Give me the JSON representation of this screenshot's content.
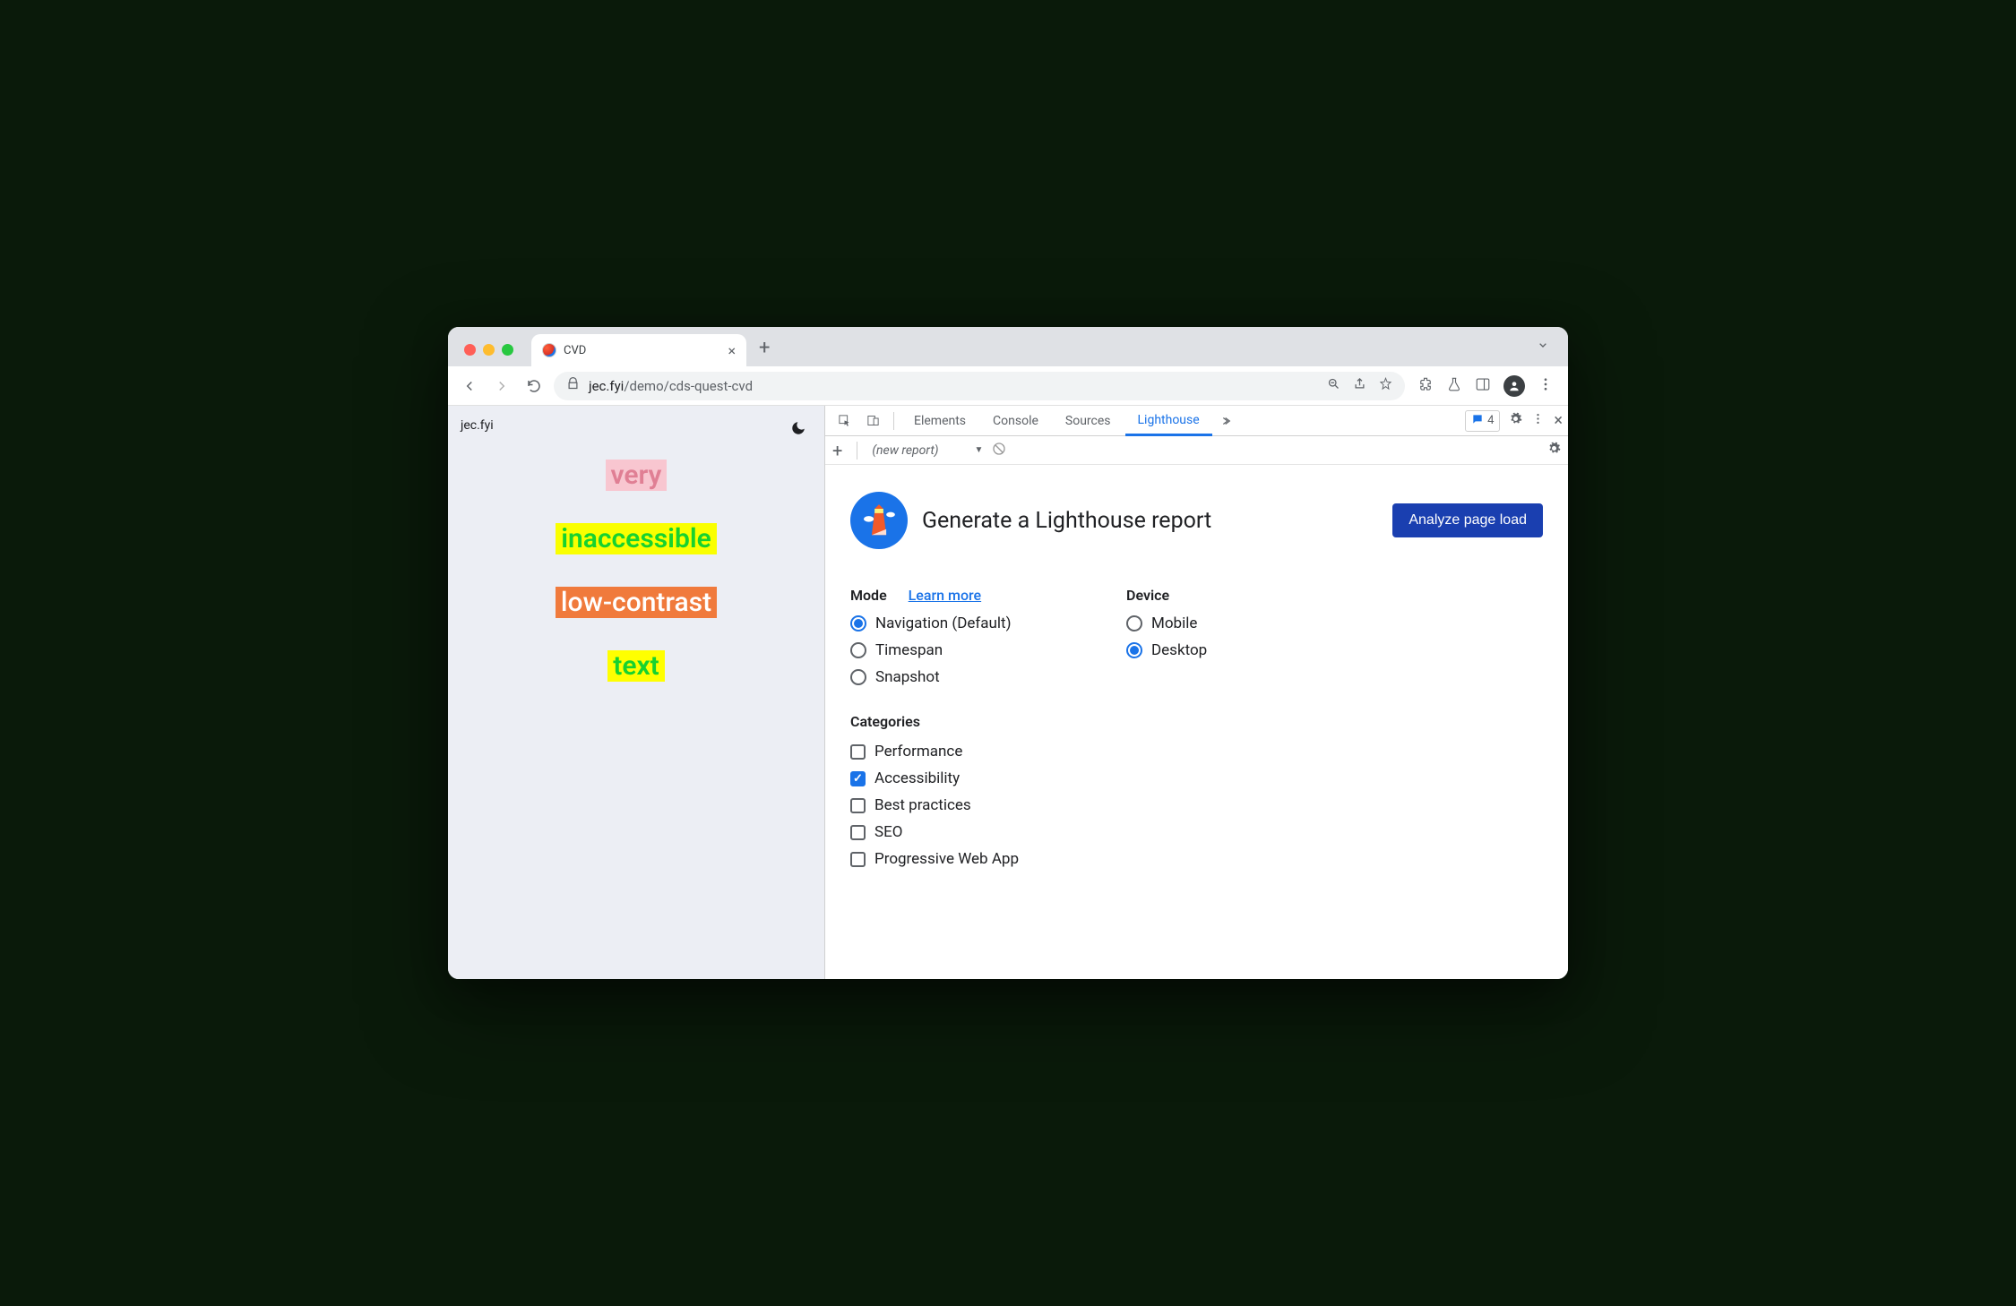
{
  "browser": {
    "tab_title": "CVD",
    "url_display": "jec.fyi/demo/cds-quest-cvd",
    "url_prefix": "jec.fyi",
    "url_suffix": "/demo/cds-quest-cvd"
  },
  "page": {
    "header": "jec.fyi",
    "words": [
      "very",
      "inaccessible",
      "low-contrast",
      "text"
    ]
  },
  "devtools": {
    "tabs": [
      "Elements",
      "Console",
      "Sources",
      "Lighthouse"
    ],
    "active_tab": "Lighthouse",
    "issues_count": "4",
    "subbar": {
      "new_report": "(new report)"
    }
  },
  "lighthouse": {
    "title": "Generate a Lighthouse report",
    "analyze_btn": "Analyze page load",
    "mode_label": "Mode",
    "learn_more": "Learn more",
    "modes": [
      {
        "label": "Navigation (Default)",
        "checked": true
      },
      {
        "label": "Timespan",
        "checked": false
      },
      {
        "label": "Snapshot",
        "checked": false
      }
    ],
    "device_label": "Device",
    "devices": [
      {
        "label": "Mobile",
        "checked": false
      },
      {
        "label": "Desktop",
        "checked": true
      }
    ],
    "categories_label": "Categories",
    "categories": [
      {
        "label": "Performance",
        "checked": false
      },
      {
        "label": "Accessibility",
        "checked": true
      },
      {
        "label": "Best practices",
        "checked": false
      },
      {
        "label": "SEO",
        "checked": false
      },
      {
        "label": "Progressive Web App",
        "checked": false
      }
    ]
  }
}
